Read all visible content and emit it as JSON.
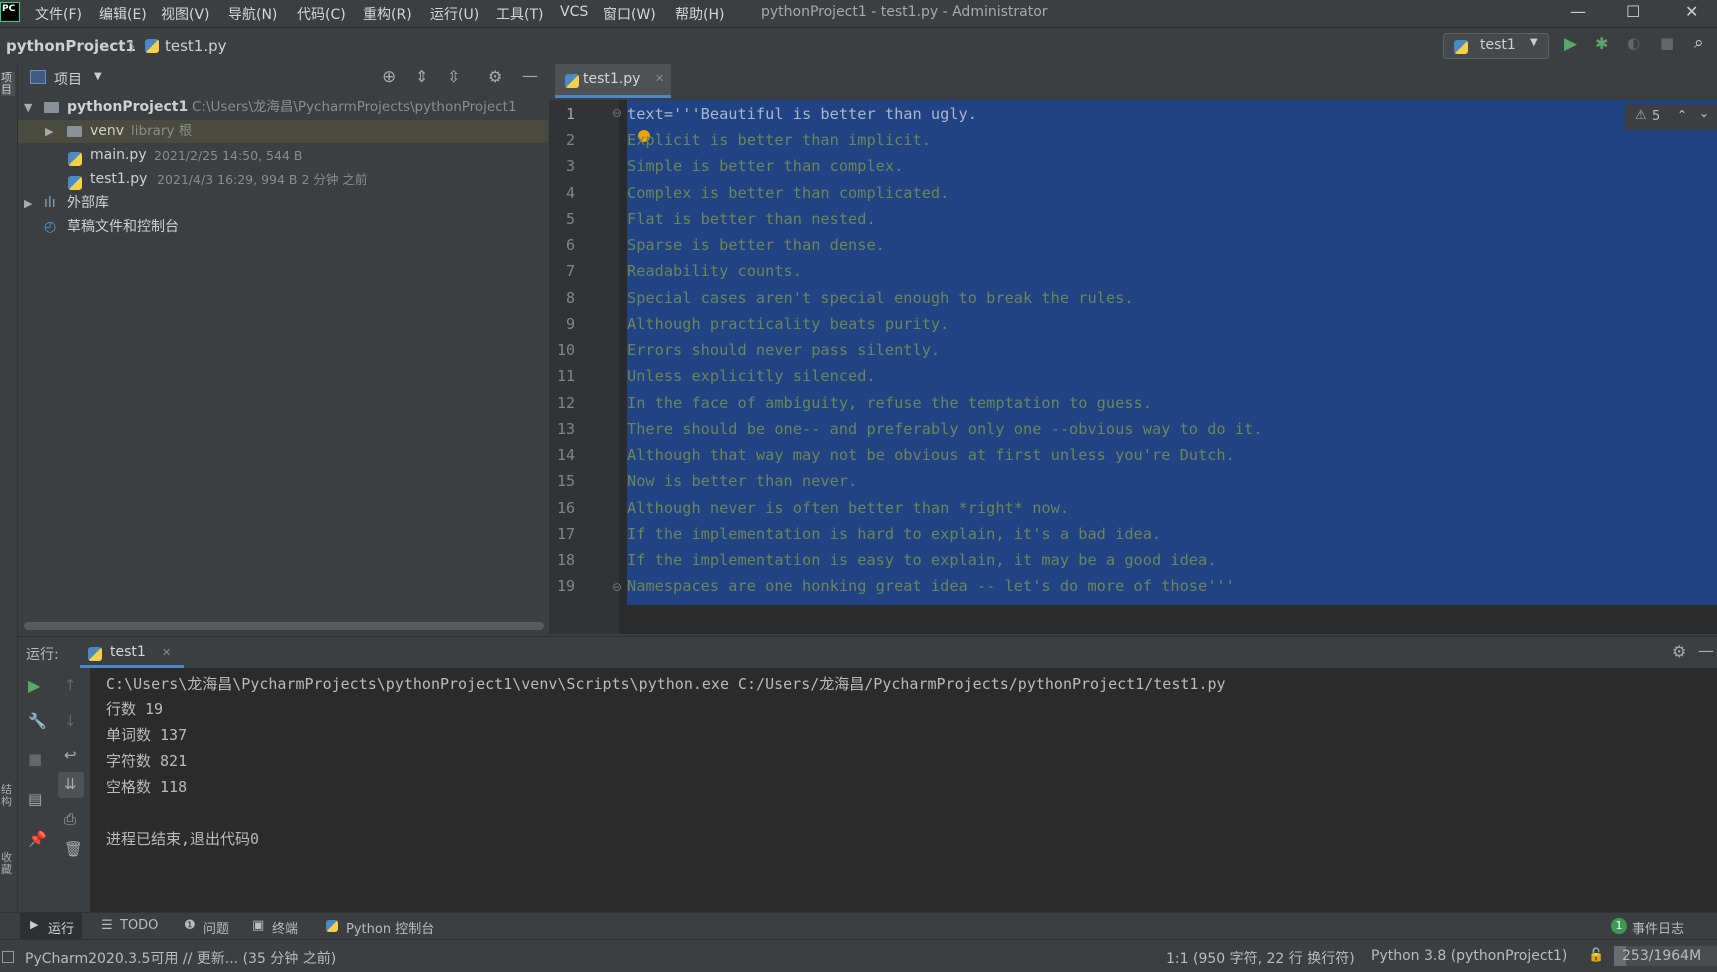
{
  "window": {
    "title": "pythonProject1 - test1.py - Administrator",
    "logo": "PC",
    "menu": [
      "文件(F)",
      "编辑(E)",
      "视图(V)",
      "导航(N)",
      "代码(C)",
      "重构(R)",
      "运行(U)",
      "工具(T)",
      "VCS",
      "窗口(W)",
      "帮助(H)"
    ]
  },
  "navbar": {
    "project": "pythonProject1",
    "separator": "〉",
    "file": "test1.py",
    "run_config": "test1"
  },
  "left_strip": {
    "project_label": "项目",
    "structure_label": "结构",
    "favorites_label": "收藏"
  },
  "project_panel": {
    "title": "项目",
    "root": {
      "name": "pythonProject1",
      "path": "C:\\Users\\龙海昌\\PycharmProjects\\pythonProject1"
    },
    "venv": {
      "name": "venv",
      "hint": "library 根"
    },
    "files": [
      {
        "name": "main.py",
        "meta": "2021/2/25 14:50, 544 B"
      },
      {
        "name": "test1.py",
        "meta": "2021/4/3 16:29, 994 B 2 分钟 之前"
      }
    ],
    "external": "外部库",
    "scratches": "草稿文件和控制台"
  },
  "editor": {
    "tab": "test1.py",
    "warnings": "5",
    "lines": [
      "text='''Beautiful is better than ugly.",
      "Explicit is better than implicit.",
      "Simple is better than complex.",
      "Complex is better than complicated.",
      "Flat is better than nested.",
      "Sparse is better than dense.",
      "Readability counts.",
      "Special cases aren't special enough to break the rules.",
      "Although practicality beats purity.",
      "Errors should never pass silently.",
      "Unless explicitly silenced.",
      "In the face of ambiguity, refuse the temptation to guess.",
      "There should be one-- and preferably only one --obvious way to do it.",
      "Although that way may not be obvious at first unless you're Dutch.",
      "Now is better than never.",
      "Although never is often better than *right* now.",
      "If the implementation is hard to explain, it's a bad idea.",
      "If the implementation is easy to explain, it may be a good idea.",
      "Namespaces are one honking great idea -- let's do more of those'''"
    ],
    "line_numbers": [
      "1",
      "2",
      "3",
      "4",
      "5",
      "6",
      "7",
      "8",
      "9",
      "10",
      "11",
      "12",
      "13",
      "14",
      "15",
      "16",
      "17",
      "18",
      "19"
    ]
  },
  "run_panel": {
    "label": "运行:",
    "tab": "test1",
    "command": "C:\\Users\\龙海昌\\PycharmProjects\\pythonProject1\\venv\\Scripts\\python.exe C:/Users/龙海昌/PycharmProjects/pythonProject1/test1.py",
    "output": [
      "行数 19",
      "单词数 137",
      "字符数 821",
      "空格数 118"
    ],
    "exit": "进程已结束,退出代码0"
  },
  "tool_tabs": {
    "run": "运行",
    "todo": "TODO",
    "problems": "问题",
    "terminal": "终端",
    "python_console": "Python 控制台",
    "event_log_count": "1",
    "event_log": "事件日志"
  },
  "status_bar": {
    "message": "PyCharm2020.3.5可用 // 更新... (35 分钟 之前)",
    "position": "1:1 (950 字符, 22 行 换行符)",
    "interpreter": "Python 3.8 (pythonProject1)",
    "memory": "253/1964M"
  }
}
